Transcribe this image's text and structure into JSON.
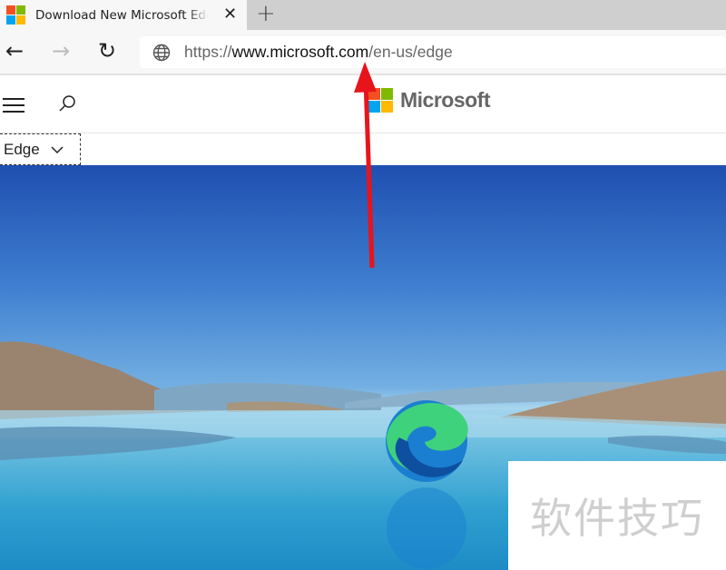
{
  "tab": {
    "title": "Download New Microsoft Edge Browser",
    "close_icon": "close-icon",
    "new_tab_icon": "plus-icon"
  },
  "toolbar": {
    "back_icon": "arrow-left-icon",
    "forward_icon": "arrow-right-icon",
    "refresh_icon": "refresh-icon",
    "site_icon": "globe-icon",
    "url_scheme": "https://",
    "url_host": "www.microsoft.com",
    "url_path": "/en-us/edge"
  },
  "header": {
    "brand": "Microsoft",
    "menu_icon": "hamburger-icon",
    "search_icon": "search-icon"
  },
  "subnav": {
    "label": "Edge"
  },
  "watermark": "软件技巧",
  "colors": {
    "ms_red": "#f25022",
    "ms_green": "#7fba00",
    "ms_blue": "#00a4ef",
    "ms_yellow": "#ffb900",
    "annotation_arrow": "#e8141c"
  }
}
